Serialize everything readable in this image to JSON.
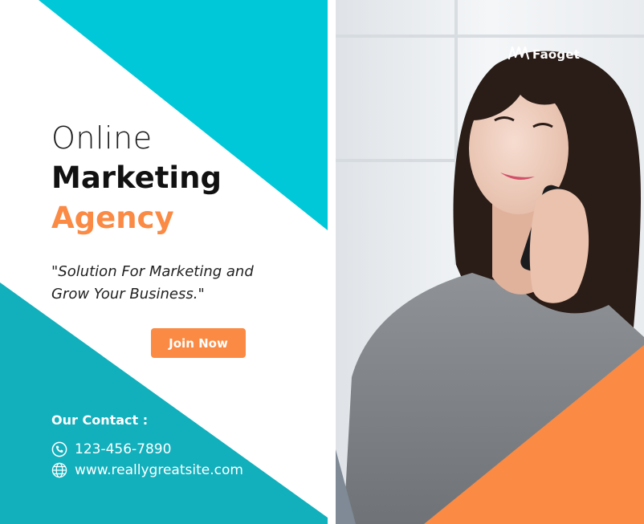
{
  "colors": {
    "teal_light": "#00c8d8",
    "teal_dark": "#12b0bc",
    "accent_orange": "#fa8a44",
    "text_dark": "#111111",
    "white": "#ffffff"
  },
  "headline": {
    "line1": "Online",
    "line2": "Marketing",
    "line3": "Agency"
  },
  "tagline": "\"Solution For Marketing and Grow Your Business.\"",
  "cta": {
    "label": "Join Now"
  },
  "contact": {
    "heading": "Our Contact :",
    "phone": "123-456-7890",
    "phone_icon": "phone-icon",
    "website": "www.reallygreatsite.com",
    "website_icon": "globe-icon"
  },
  "logo": {
    "text": "Faoget"
  },
  "photo": {
    "subject": "woman-on-phone-photo"
  }
}
